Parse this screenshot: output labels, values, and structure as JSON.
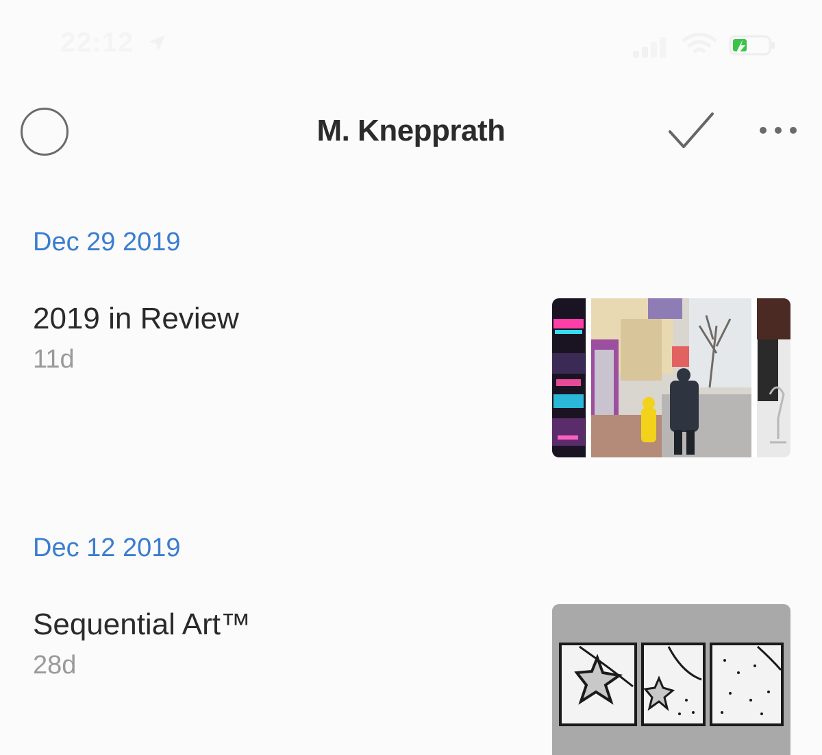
{
  "status_bar": {
    "time": "22:12",
    "icons": [
      "location-arrow-icon",
      "signal-icon",
      "wifi-icon",
      "battery-icon"
    ],
    "battery_color": "#3cc24a"
  },
  "header": {
    "title": "M. Knepprath",
    "left_icon": "select-circle-icon",
    "right_icons": [
      "checkmark-icon",
      "more-icon"
    ]
  },
  "entries": [
    {
      "date": "Dec 29 2019",
      "title": "2019 in Review",
      "age": "11d",
      "thumbnail": "photo-collage"
    },
    {
      "date": "Dec 12 2019",
      "title": "Sequential Art™",
      "age": "28d",
      "thumbnail": "sketch-panels"
    }
  ],
  "colors": {
    "accent": "#3b7dd0",
    "background": "#fbfbfb",
    "muted_text": "#9a9a9a"
  }
}
